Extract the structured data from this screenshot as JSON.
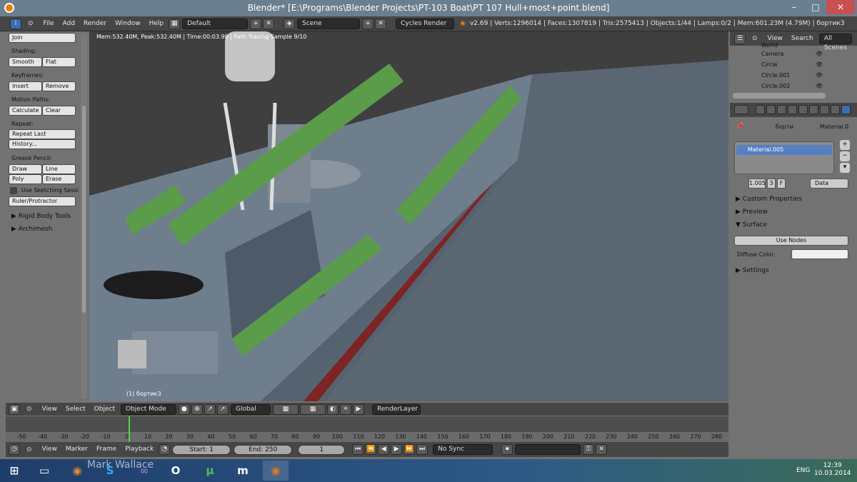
{
  "title": "Blender* [E:\\Programs\\Blender Projects\\PT-103 Boat\\PT 107 Hull+most+point.blend]",
  "menus": [
    "File",
    "Add",
    "Render",
    "Window",
    "Help"
  ],
  "layout": "Default",
  "scene": "Scene",
  "engine": "Cycles Render",
  "stats": "v2.69 | Verts:1296014 | Faces:1307819 | Tris:2575413 | Objects:1/44 | Lamps:0/2 | Mem:601.23M (4.79M) | бортик3",
  "tools": {
    "join": "Join",
    "shading": "Shading:",
    "smooth": "Smooth",
    "flat": "Flat",
    "keyframes": "Keyframes:",
    "insert": "Insert",
    "remove": "Remove",
    "motion": "Motion Paths:",
    "calculate": "Calculate",
    "clear": "Clear",
    "repeat": "Repeat:",
    "repeat_last": "Repeat Last",
    "history": "History...",
    "grease": "Grease Pencil:",
    "draw": "Draw",
    "line": "Line",
    "poly": "Poly",
    "erase": "Erase",
    "sketch": "Use Sketching Sessi",
    "ruler": "Ruler/Protractor",
    "rigid": "Rigid Body Tools",
    "archimesh": "Archimesh"
  },
  "viewport": {
    "info": "Mem:532.40M, Peak:532.40M | Time:00:03.98 | Path Tracing Sample 9/10",
    "object": "(1) бортик3"
  },
  "vphead": {
    "view": "View",
    "select": "Select",
    "object": "Object",
    "mode": "Object Mode",
    "orient": "Global",
    "layer": "RenderLayer"
  },
  "ruler_ticks": [
    "-50",
    "-40",
    "-30",
    "-20",
    "-10",
    "0",
    "10",
    "20",
    "30",
    "40",
    "50",
    "60",
    "70",
    "80",
    "90",
    "100",
    "110",
    "120",
    "130",
    "140",
    "150",
    "160",
    "170",
    "180",
    "190",
    "200",
    "210",
    "220",
    "230",
    "240",
    "250",
    "260",
    "270",
    "280"
  ],
  "tlhead": {
    "view": "View",
    "marker": "Marker",
    "frame": "Frame",
    "playback": "Playback",
    "start": "Start: 1",
    "end": "End: 250",
    "current": "1",
    "sync": "No Sync"
  },
  "outliner": {
    "view": "View",
    "search": "Search",
    "scenes": "All Scenes",
    "rows": [
      "World",
      "Camera",
      "Circle",
      "Circle.001",
      "Circle.002"
    ]
  },
  "props": {
    "crumb1": "борти",
    "crumb2": "Material.0",
    "material": "Material.005",
    "users": "1.005",
    "count": "3",
    "fake": "F",
    "data": "Data",
    "custom": "Custom Properties",
    "preview": "Preview",
    "surface": "Surface",
    "nodes": "Use Nodes",
    "diffuse": "Diffuse Color:",
    "settings": "Settings"
  },
  "taskbar": {
    "watermark": "Mark Wallace",
    "lang": "ENG",
    "time": "12:39",
    "date": "10.03.2014"
  }
}
